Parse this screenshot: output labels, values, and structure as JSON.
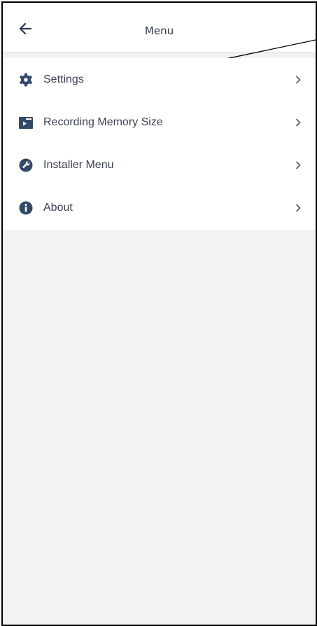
{
  "header": {
    "title": "Menu",
    "back_icon": "arrow-left-icon"
  },
  "menu": {
    "items": [
      {
        "label": "Settings",
        "icon": "gear-icon"
      },
      {
        "label": "Recording Memory Size",
        "icon": "folder-play-icon"
      },
      {
        "label": "Installer Menu",
        "icon": "wrench-icon"
      },
      {
        "label": "About",
        "icon": "info-icon"
      }
    ]
  },
  "colors": {
    "icon": "#324967",
    "text": "#3d4254",
    "background": "#f2f2f2",
    "surface": "#ffffff"
  }
}
